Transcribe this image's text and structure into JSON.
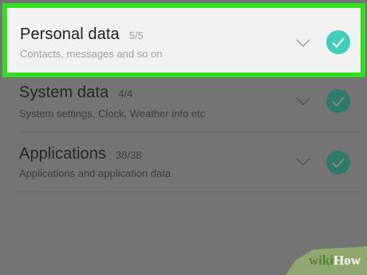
{
  "rows": [
    {
      "title": "Personal data",
      "count": "5/5",
      "subtitle": "Contacts, messages and so on",
      "checked": true
    },
    {
      "title": "System data",
      "count": "4/4",
      "subtitle": "System settings, Clock, Weather info etc",
      "checked": true
    },
    {
      "title": "Applications",
      "count": "38/38",
      "subtitle": "Applications and application data",
      "checked": true
    }
  ],
  "colors": {
    "highlight_border": "#30e11d",
    "check_active": "#3fcfba",
    "check_dim": "#2e7b6c",
    "overlay": "#747474"
  },
  "icons": {
    "expand": "chevron-down-icon",
    "check": "checkmark-circle-icon"
  },
  "watermark": {
    "wiki": "wiki",
    "how": "How"
  }
}
